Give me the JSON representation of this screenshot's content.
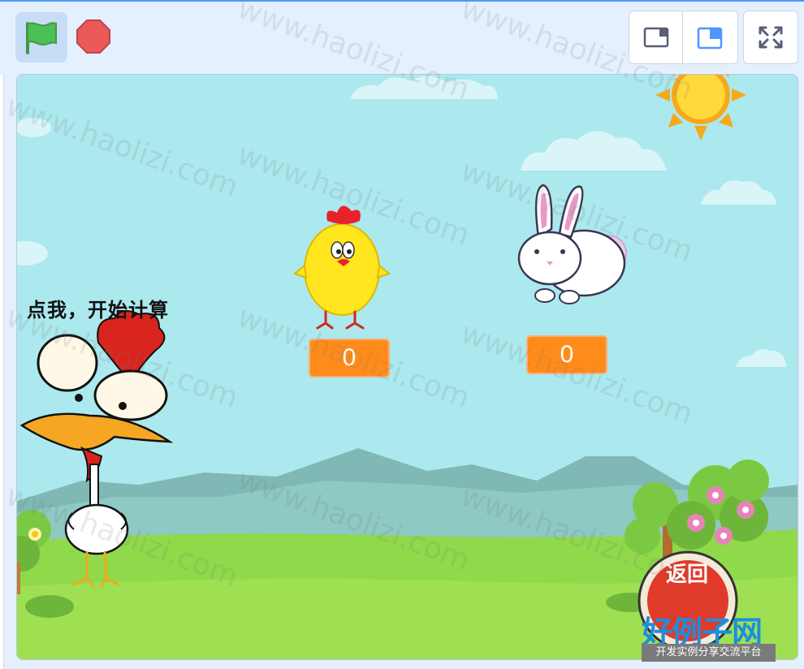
{
  "controls": {
    "flag_icon": "green-flag-icon",
    "stop_icon": "stop-icon",
    "small_stage_icon": "small-stage-icon",
    "normal_stage_icon": "normal-stage-icon",
    "fullscreen_icon": "fullscreen-icon"
  },
  "stage": {
    "speech_text": "点我，开始计算",
    "chick_counter": "0",
    "rabbit_counter": "0"
  },
  "watermark": {
    "text": "www.haolizi.com",
    "logo_title": "好例子网",
    "logo_subtitle": "开发实例分享交流平台",
    "back_badge": "返回"
  },
  "colors": {
    "accent": "#4c97ff",
    "monitor": "#ff8c1a",
    "sky": "#abe9ee",
    "grass": "#8fd94a"
  }
}
